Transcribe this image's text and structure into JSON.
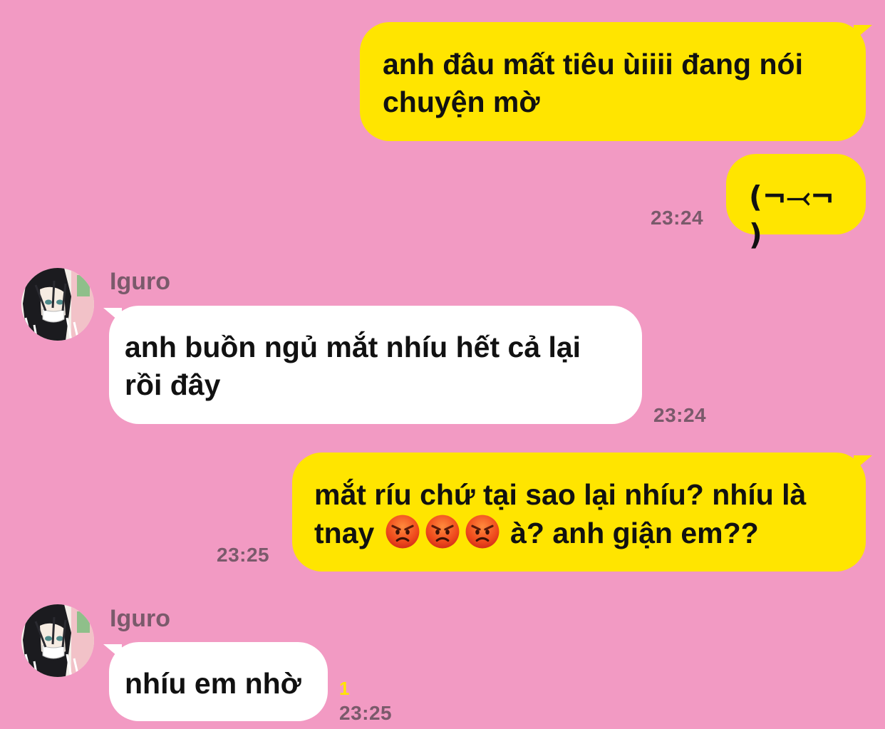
{
  "theme": {
    "background": "#f29ac3",
    "outgoing_bubble": "#ffe500",
    "incoming_bubble": "#ffffff",
    "meta_text": "#7a5a6b",
    "read_count": "#ffe500"
  },
  "messages": [
    {
      "direction": "outgoing",
      "text_line1": "anh đâu mất tiêu ùiiii đang nói",
      "text_line2": "chuyện mờ"
    },
    {
      "direction": "outgoing",
      "text": "(¬⤙¬ )",
      "time": "23:24"
    },
    {
      "direction": "incoming",
      "sender": "Iguro",
      "avatar": "character-avatar",
      "text_line1": "anh buồn ngủ mắt nhíu hết cả lại",
      "text_line2": "rồi đây",
      "time": "23:24"
    },
    {
      "direction": "outgoing",
      "text_line1": "mắt ríu chứ tại sao lại nhíu? nhíu là",
      "text_line2_prefix": "tnay",
      "emojis": [
        "angry-face-emoji",
        "angry-face-emoji",
        "angry-face-emoji"
      ],
      "text_line2_suffix": "à? anh giận em??",
      "time": "23:25"
    },
    {
      "direction": "incoming",
      "sender": "Iguro",
      "avatar": "character-avatar",
      "text": "nhíu em nhờ",
      "read_count": "1",
      "time": "23:25"
    }
  ]
}
